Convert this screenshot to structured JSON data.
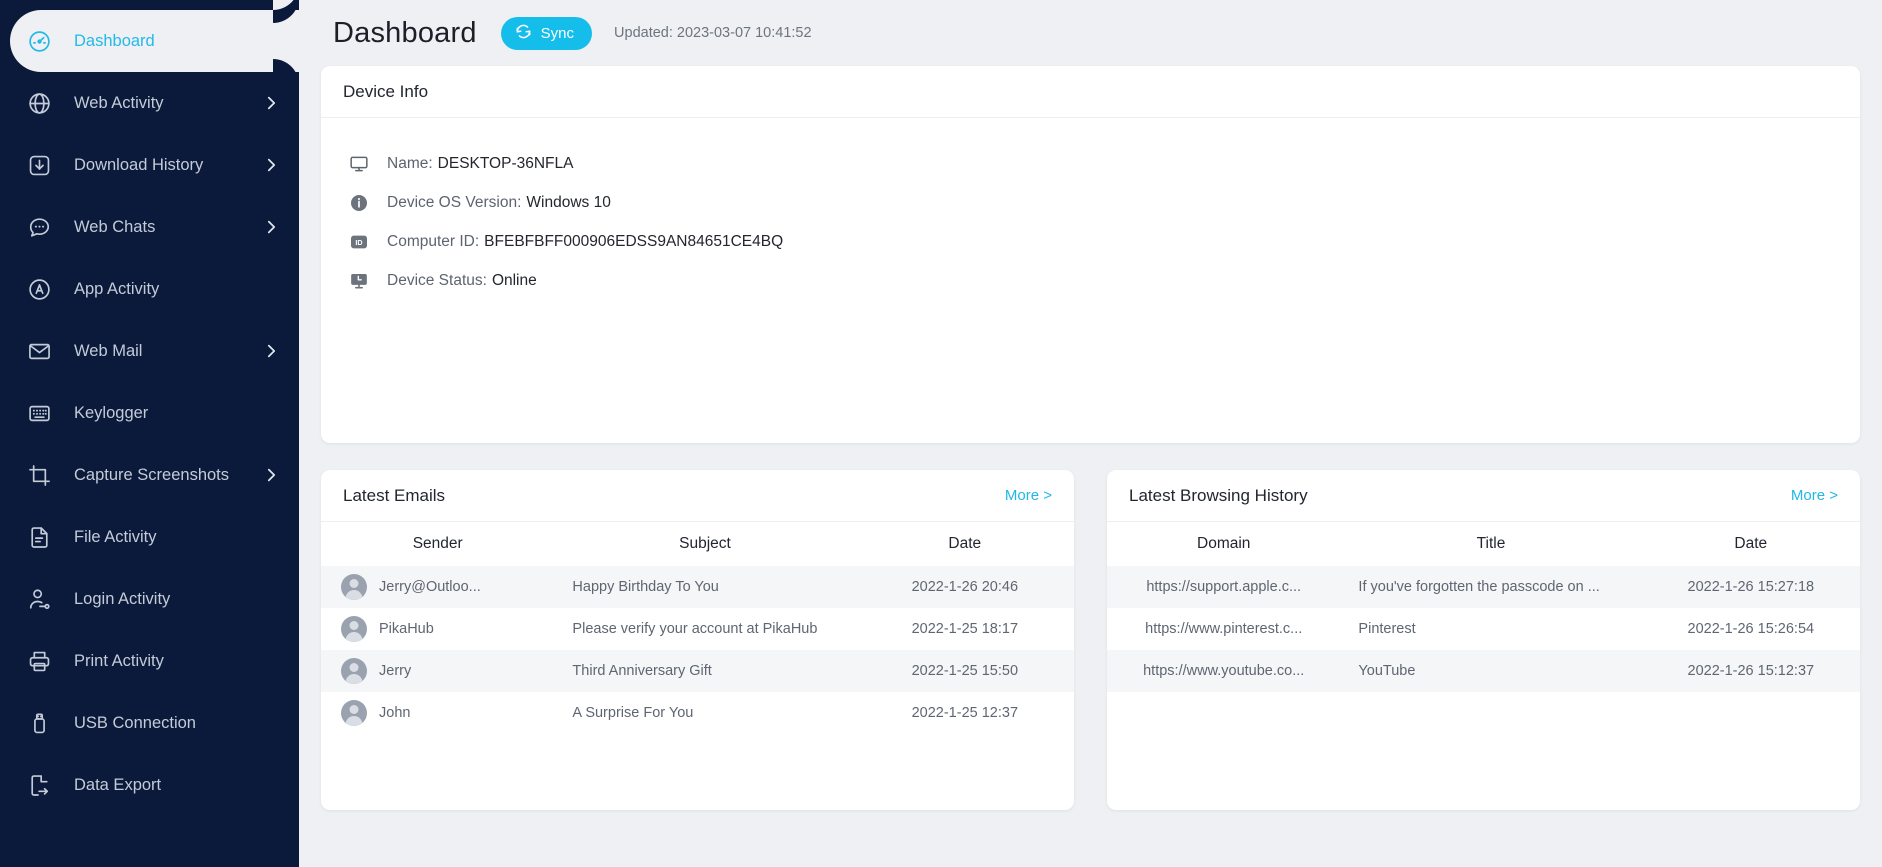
{
  "colors": {
    "sidebar_bg": "#0b1a3a",
    "accent": "#15bdeb",
    "page_bg": "#eef0f3",
    "active_text": "#24b9e8"
  },
  "sidebar": {
    "items": [
      {
        "label": "Dashboard",
        "icon": "gauge-icon",
        "active": true,
        "chevron": false
      },
      {
        "label": "Web Activity",
        "icon": "globe-icon",
        "active": false,
        "chevron": true
      },
      {
        "label": "Download History",
        "icon": "download-icon",
        "active": false,
        "chevron": true
      },
      {
        "label": "Web Chats",
        "icon": "chat-bubble-icon",
        "active": false,
        "chevron": true
      },
      {
        "label": "App Activity",
        "icon": "app-circle-icon",
        "active": false,
        "chevron": false
      },
      {
        "label": "Web Mail",
        "icon": "envelope-icon",
        "active": false,
        "chevron": true
      },
      {
        "label": "Keylogger",
        "icon": "keyboard-icon",
        "active": false,
        "chevron": false
      },
      {
        "label": "Capture Screenshots",
        "icon": "crop-icon",
        "active": false,
        "chevron": true
      },
      {
        "label": "File Activity",
        "icon": "document-icon",
        "active": false,
        "chevron": false
      },
      {
        "label": "Login Activity",
        "icon": "user-key-icon",
        "active": false,
        "chevron": false
      },
      {
        "label": "Print Activity",
        "icon": "printer-icon",
        "active": false,
        "chevron": false
      },
      {
        "label": "USB Connection",
        "icon": "usb-icon",
        "active": false,
        "chevron": false
      },
      {
        "label": "Data Export",
        "icon": "file-export-icon",
        "active": false,
        "chevron": false
      }
    ]
  },
  "header": {
    "title": "Dashboard",
    "sync_label": "Sync",
    "sync_icon": "refresh-icon",
    "updated": "Updated: 2023-03-07 10:41:52"
  },
  "device_info": {
    "title": "Device Info",
    "rows": [
      {
        "icon": "monitor-icon",
        "key": "Name:",
        "value": "DESKTOP-36NFLA"
      },
      {
        "icon": "info-icon",
        "key": "Device OS Version:",
        "value": "Windows 10"
      },
      {
        "icon": "id-icon",
        "key": "Computer ID:",
        "value": "BFEBFBFF000906EDSS9AN84651CE4BQ"
      },
      {
        "icon": "status-icon",
        "key": "Device Status:",
        "value": "Online"
      }
    ]
  },
  "latest_emails": {
    "title": "Latest Emails",
    "more_label": "More >",
    "columns": [
      "Sender",
      "Subject",
      "Date"
    ],
    "rows": [
      {
        "sender": "Jerry@Outloo...",
        "subject": "Happy Birthday To You",
        "date": "2022-1-26 20:46"
      },
      {
        "sender": "PikaHub",
        "subject": "Please verify your account at PikaHub",
        "date": "2022-1-25 18:17"
      },
      {
        "sender": "Jerry",
        "subject": "Third Anniversary Gift",
        "date": "2022-1-25 15:50"
      },
      {
        "sender": "John",
        "subject": "A Surprise For You",
        "date": "2022-1-25 12:37"
      }
    ]
  },
  "latest_browsing": {
    "title": "Latest Browsing History",
    "more_label": "More >",
    "columns": [
      "Domain",
      "Title",
      "Date"
    ],
    "rows": [
      {
        "domain": "https://support.apple.c...",
        "title": "If you've forgotten the passcode on ...",
        "date": "2022-1-26 15:27:18"
      },
      {
        "domain": "https://www.pinterest.c...",
        "title": "Pinterest",
        "date": "2022-1-26 15:26:54"
      },
      {
        "domain": "https://www.youtube.co...",
        "title": "YouTube",
        "date": "2022-1-26 15:12:37"
      }
    ]
  }
}
